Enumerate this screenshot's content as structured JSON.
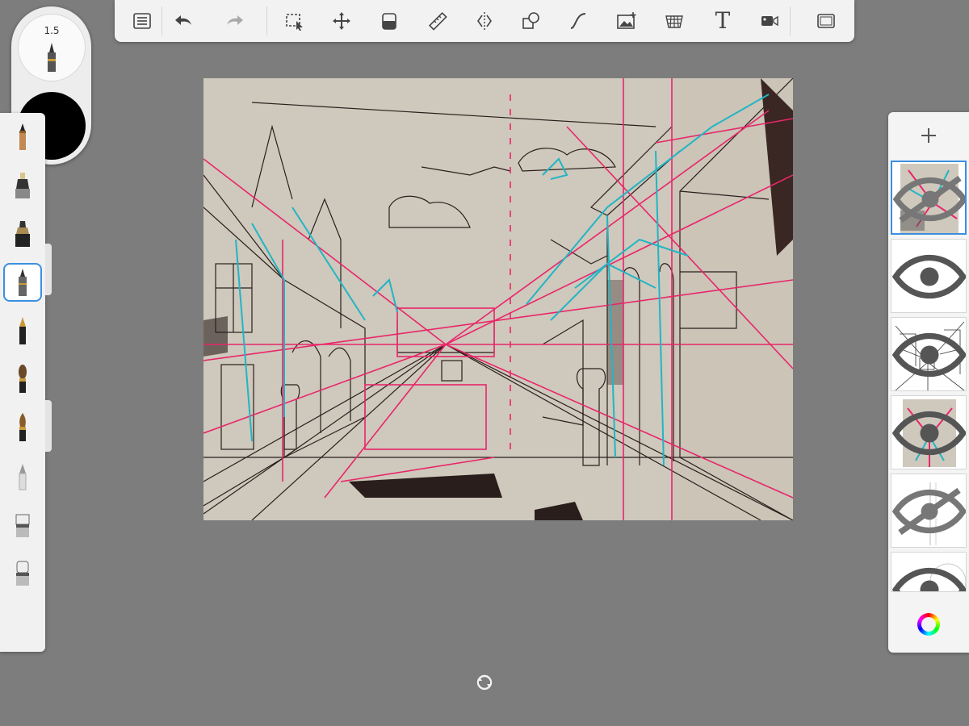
{
  "toolbar": {
    "items": [
      {
        "name": "list-icon"
      },
      {
        "name": "undo-icon"
      },
      {
        "name": "redo-icon"
      },
      {
        "name": "selection-icon"
      },
      {
        "name": "transform-icon"
      },
      {
        "name": "fill-icon"
      },
      {
        "name": "ruler-icon"
      },
      {
        "name": "symmetry-icon"
      },
      {
        "name": "shapes-icon"
      },
      {
        "name": "curve-icon"
      },
      {
        "name": "add-image-icon"
      },
      {
        "name": "perspective-icon"
      },
      {
        "name": "text-tool-icon",
        "label": "T"
      },
      {
        "name": "video-icon"
      },
      {
        "name": "fullscreen-icon"
      }
    ]
  },
  "brush": {
    "size_label": "1.5",
    "color": "#000000"
  },
  "palette": {
    "tools": [
      "pencil-icon",
      "marker-icon",
      "chisel-marker-icon",
      "technical-pen-icon",
      "fountain-pen-icon",
      "paintbrush-icon",
      "ink-brush-icon",
      "airbrush-icon",
      "eraser-icon",
      "soft-eraser-icon"
    ],
    "selected_index": 3
  },
  "layers": {
    "items": [
      {
        "name": "layer-1",
        "visible": false,
        "selected": true
      },
      {
        "name": "layer-2",
        "visible": true,
        "selected": false
      },
      {
        "name": "layer-3",
        "visible": true,
        "selected": false
      },
      {
        "name": "layer-4",
        "visible": true,
        "selected": false
      },
      {
        "name": "layer-5",
        "visible": false,
        "selected": false
      },
      {
        "name": "layer-6",
        "visible": true,
        "selected": false
      }
    ]
  },
  "colors": {
    "background": "#7d7d7d",
    "paper": "#c9c2b5",
    "ink": "#2a1e1c",
    "pink_guides": "#e8266a",
    "cyan_guides": "#22b5c4",
    "selection_blue": "#3b8fe0"
  }
}
